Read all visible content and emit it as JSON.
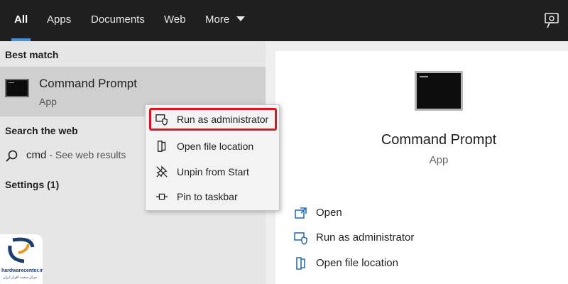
{
  "tabs": [
    {
      "label": "All"
    },
    {
      "label": "Apps"
    },
    {
      "label": "Documents"
    },
    {
      "label": "Web"
    },
    {
      "label": "More"
    }
  ],
  "left": {
    "best_match_heading": "Best match",
    "best_match": {
      "title": "Command Prompt",
      "subtitle": "App"
    },
    "search_web_heading": "Search the web",
    "web_query": "cmd",
    "web_hint": " - See web results",
    "settings_heading": "Settings (1)"
  },
  "context_menu": {
    "items": [
      {
        "label": "Run as administrator",
        "icon": "shield-icon"
      },
      {
        "label": "Open file location",
        "icon": "file-location-icon"
      },
      {
        "label": "Unpin from Start",
        "icon": "unpin-icon"
      },
      {
        "label": "Pin to taskbar",
        "icon": "pin-icon"
      }
    ]
  },
  "right": {
    "title": "Command Prompt",
    "subtitle": "App",
    "actions": [
      {
        "label": "Open",
        "icon": "open-icon"
      },
      {
        "label": "Run as administrator",
        "icon": "shield-icon"
      },
      {
        "label": "Open file location",
        "icon": "file-location-icon"
      }
    ]
  },
  "logo": {
    "name": "hardwarecenter.ir",
    "tagline": "مرکز سخت افزار ایران"
  },
  "colors": {
    "topbar": "#1f1f1f",
    "accent": "#4a90d9",
    "highlight_border": "#e0141e",
    "icon_blue": "#2a6fb5"
  }
}
